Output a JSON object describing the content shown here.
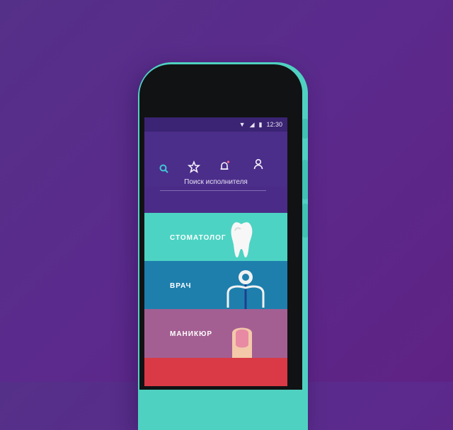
{
  "status_bar": {
    "time": "12:30"
  },
  "nav": {
    "search_icon": "search-icon",
    "favorites_icon": "star-icon",
    "notifications_icon": "bell-icon",
    "profile_icon": "user-icon"
  },
  "search": {
    "label": "Поиск исполнителя"
  },
  "categories": [
    {
      "label": "СТОМАТОЛОГ",
      "color": "#4dd3c3",
      "icon": "tooth-icon"
    },
    {
      "label": "ВРАЧ",
      "color": "#1e7fad",
      "icon": "stethoscope-icon"
    },
    {
      "label": "МАНИКЮР",
      "color": "#a45f92",
      "icon": "nail-icon"
    },
    {
      "label": "",
      "color": "#d93a46",
      "icon": ""
    }
  ],
  "colors": {
    "accent": "#4fd1c1",
    "background": "#5b2a8c"
  }
}
